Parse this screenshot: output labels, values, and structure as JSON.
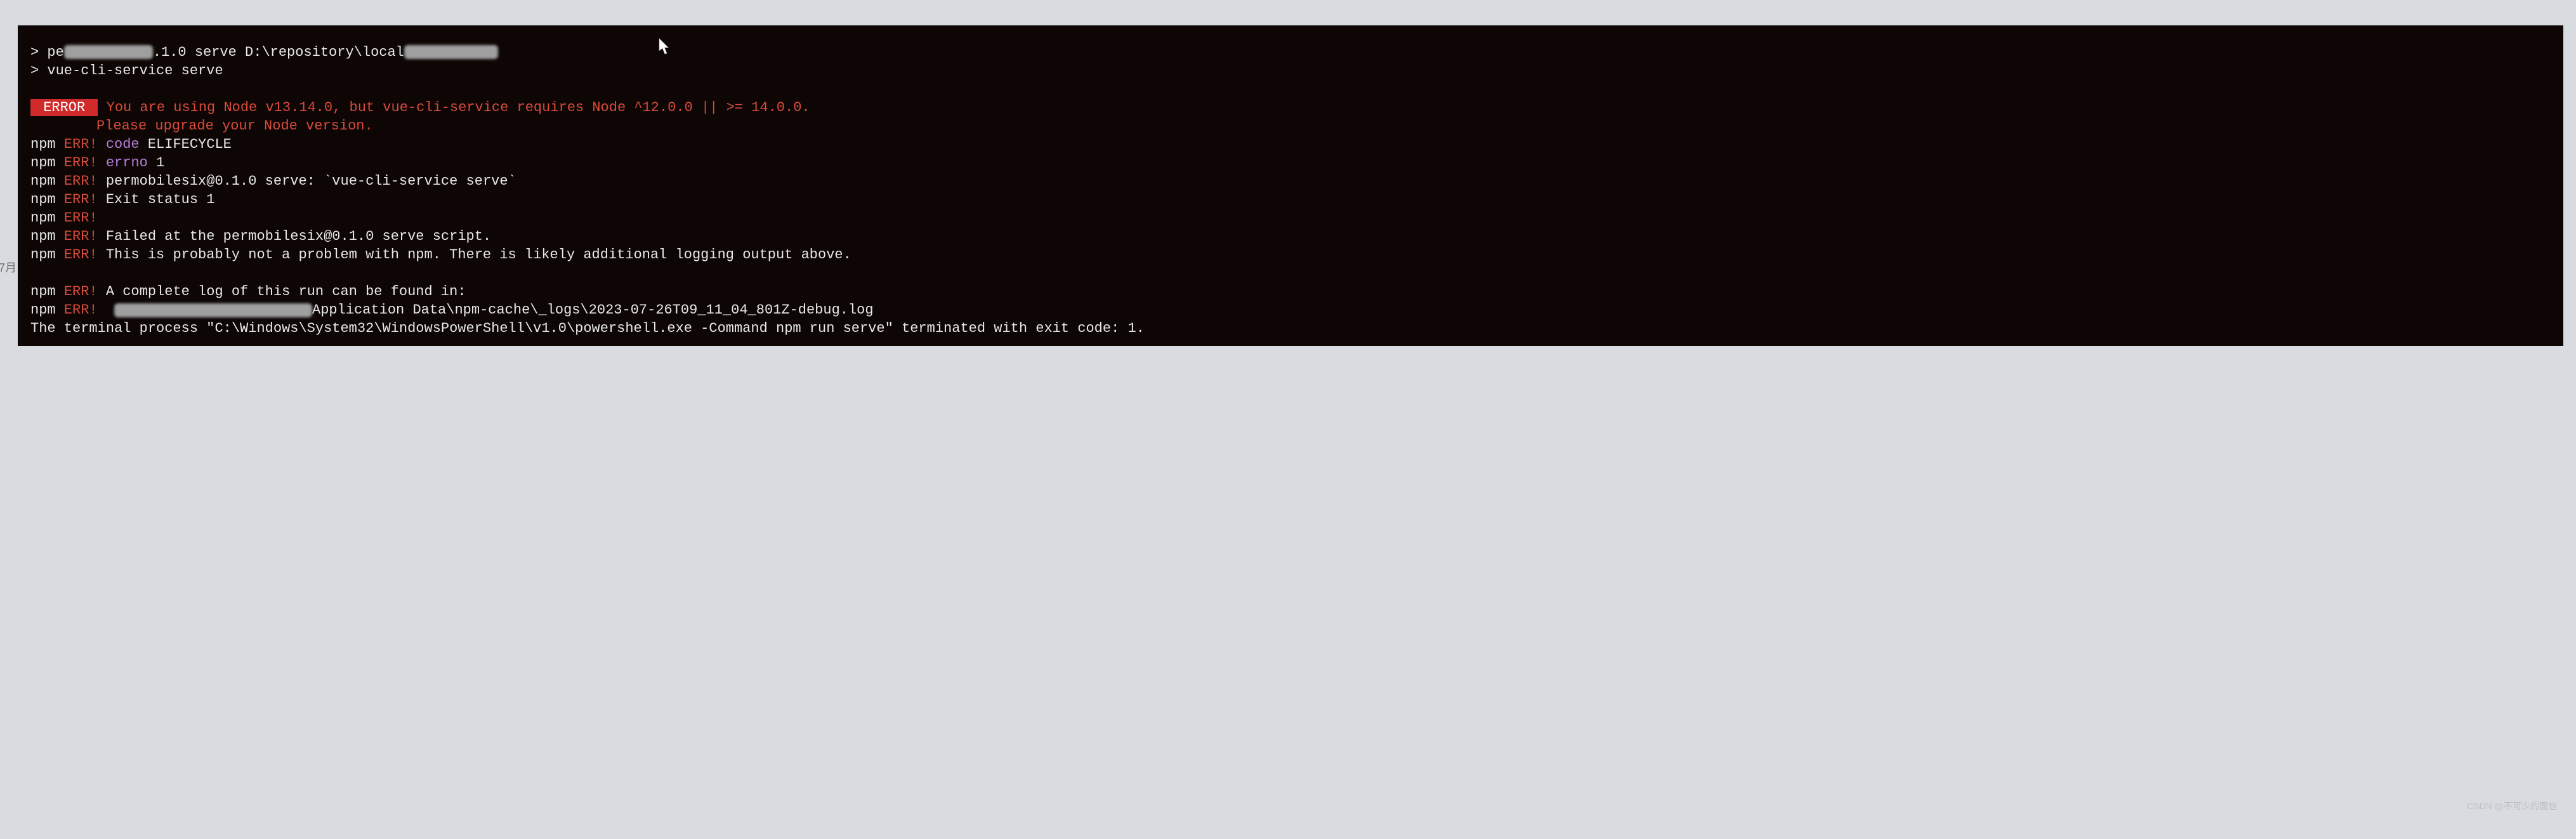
{
  "cmd1_prefix": "> pe",
  "cmd1_suffix": ".1.0 serve D:\\repository\\local",
  "cmd2": "> vue-cli-service serve",
  "error_badge": " ERROR ",
  "error_msg1": " You are using Node v13.14.0, but vue-cli-service requires Node ^12.0.0 || >= 14.0.0.",
  "error_msg2": "Please upgrade your Node version.",
  "npm": "npm",
  "err": " ERR!",
  "l1_code": " code",
  "l1_val": " ELIFECYCLE",
  "l2_errno": " errno",
  "l2_val": " 1",
  "l3": " permobilesix@0.1.0 serve: `vue-cli-service serve`",
  "l4": " Exit status 1",
  "l5": " ",
  "l6": " Failed at the permobilesix@0.1.0 serve script.",
  "l7": " This is probably not a problem with npm. There is likely additional logging output above.",
  "l8": " A complete log of this run can be found in:",
  "l9_suffix": "Application Data\\npm-cache\\_logs\\2023-07-26T09_11_04_801Z-debug.log",
  "terminal_exit": "The terminal process \"C:\\Windows\\System32\\WindowsPowerShell\\v1.0\\powershell.exe -Command npm run serve\" terminated with exit code: 1.",
  "sidebar": "7月",
  "watermark": "CSDN @不可少的面包"
}
